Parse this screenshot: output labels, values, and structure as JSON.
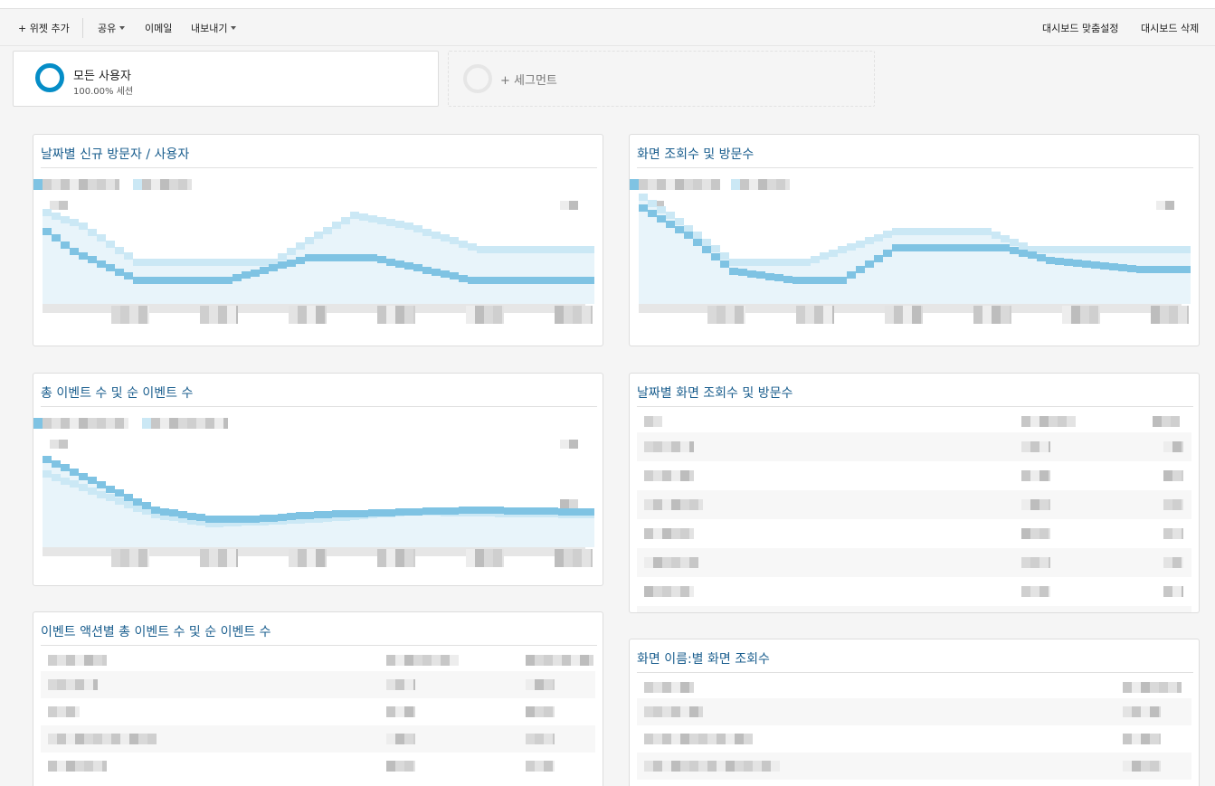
{
  "toolbar": {
    "add_widget": "+ 위젯 추가",
    "share": "공유",
    "email": "이메일",
    "export": "내보내기",
    "customize": "대시보드 맞춤설정",
    "delete": "대시보드 삭제"
  },
  "segments": {
    "active": {
      "title": "모든 사용자",
      "subtitle": "100.00% 세션"
    },
    "add": "+ 세그먼트"
  },
  "widgets": {
    "new_visitors": {
      "title": "날짜별 신규 방문자 / 사용자"
    },
    "pageviews_visits": {
      "title": "화면 조회수 및 방문수"
    },
    "events": {
      "title": "총 이벤트 수 및 순 이벤트 수"
    },
    "pageviews_by_date": {
      "title": "날짜별 화면 조회수 및 방문수"
    },
    "events_by_action": {
      "title": "이벤트 액션별 총 이벤트 수 및 순 이벤트 수"
    },
    "pageviews_by_screen": {
      "title": "화면 이름:별 화면 조회수"
    }
  },
  "colors": {
    "accent": "#058dc7",
    "title": "#1a5e8e",
    "series_primary": "#7fc3e3",
    "series_secondary": "#cbe8f5",
    "area_fill": "#e8f4fa"
  }
}
